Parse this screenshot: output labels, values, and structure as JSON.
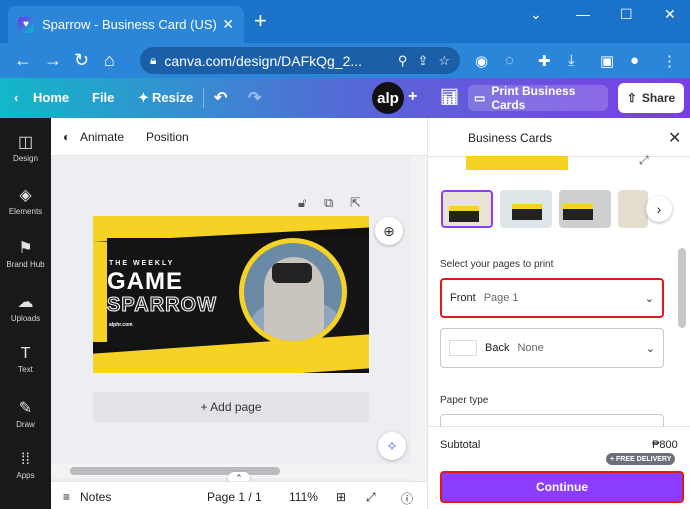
{
  "browser": {
    "tab_title": "Sparrow - Business Card (US)",
    "tab_close": "✕",
    "new_tab": "+",
    "url": "canva.com/design/DAFkQg_2...",
    "window_minimize": "—",
    "window_maximize": "☐",
    "window_close": "✕",
    "chevron": "⌄"
  },
  "header": {
    "home": "Home",
    "file": "File",
    "resize": "Resize",
    "avatar_text": "alp",
    "print_label": "Print Business Cards",
    "share_label": "Share",
    "colors": {
      "gradient_start": "#13b7c9",
      "gradient_end": "#7b3ee6"
    }
  },
  "rail": {
    "items": [
      {
        "label": "Design",
        "icon": "design-icon"
      },
      {
        "label": "Elements",
        "icon": "elements-icon"
      },
      {
        "label": "Brand Hub",
        "icon": "brand-hub-icon"
      },
      {
        "label": "Uploads",
        "icon": "uploads-icon"
      },
      {
        "label": "Text",
        "icon": "text-icon"
      },
      {
        "label": "Draw",
        "icon": "draw-icon"
      },
      {
        "label": "Apps",
        "icon": "apps-icon"
      }
    ]
  },
  "toolbar": {
    "animate": "Animate",
    "position": "Position"
  },
  "card": {
    "weekly": "THE WEEKLY",
    "game": "GAME",
    "sparrow": "SPARROW",
    "site": "alphr.com",
    "accent": "#f5d223"
  },
  "canvas": {
    "add_page": "+ Add page"
  },
  "footer": {
    "notes": "Notes",
    "page_indicator": "Page 1 / 1",
    "zoom": "111%"
  },
  "panel": {
    "title": "Business Cards",
    "select_pages_label": "Select your pages to print",
    "front": {
      "main": "Front",
      "sub": "Page 1"
    },
    "back": {
      "main": "Back",
      "sub": "None"
    },
    "paper_type_label": "Paper type",
    "subtotal_label": "Subtotal",
    "price": "₱800",
    "free_delivery": "+ FREE DELIVERY",
    "continue_label": "Continue",
    "colors": {
      "highlight": "#e0181b",
      "primary": "#8b3dff"
    }
  }
}
